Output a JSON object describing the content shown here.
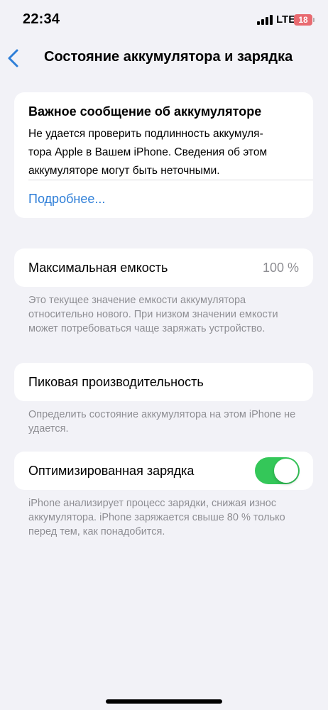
{
  "status": {
    "time": "22:34",
    "network": "LTE",
    "battery": "18"
  },
  "nav": {
    "title": "Состояние аккумулятора и зарядка"
  },
  "alert": {
    "title": "Важное сообщение об аккумуляторе",
    "line1": "Не удается проверить подлинность аккумуля-",
    "line2": "тора Apple в Вашем iPhone. Сведения об этом",
    "line3": "аккумуляторе могут быть неточными.",
    "link": "Подробнее..."
  },
  "capacity": {
    "label": "Максимальная емкость",
    "value": "100 %",
    "footnote": "Это текущее значение емкости аккумулятора относительно нового. При низком значении емкости может потребоваться чаще заряжать устройство."
  },
  "peak": {
    "label": "Пиковая производительность",
    "footnote": "Определить состояние аккумулятора на этом iPhone не удается."
  },
  "optimized": {
    "label": "Оптимизированная зарядка",
    "enabled": true,
    "footnote": "iPhone анализирует процесс зарядки, снижая износ аккумулятора. iPhone заряжается свыше 80 % только перед тем, как понадобится."
  },
  "colors": {
    "accent": "#2f7fd8",
    "toggle_on": "#34c759",
    "battery_low": "#e86a70",
    "background": "#f2f2f7"
  },
  "icons": [
    "back-chevron-icon",
    "cellular-signal-icon",
    "battery-icon"
  ]
}
